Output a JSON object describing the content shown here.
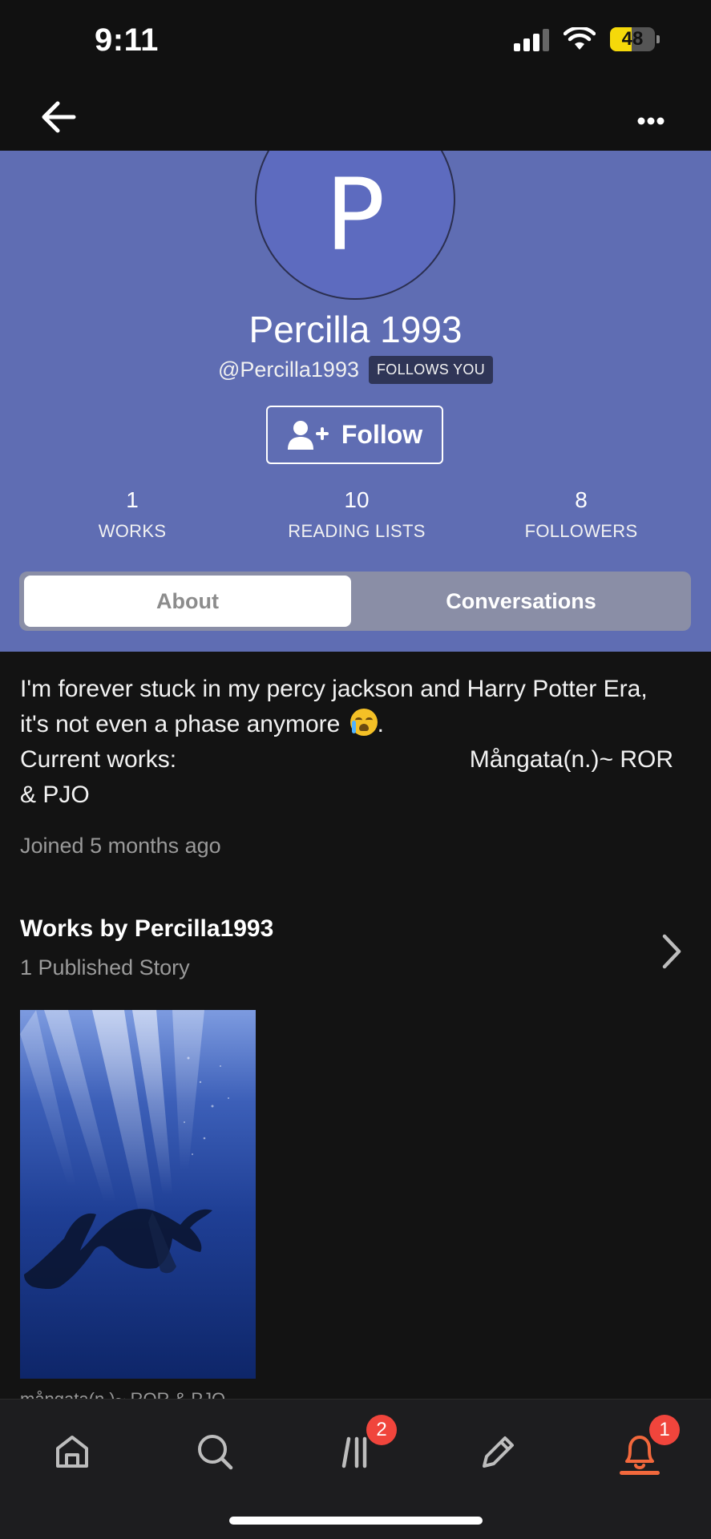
{
  "status_bar": {
    "time": "9:11",
    "battery": "48"
  },
  "nav": {
    "back_icon": "arrow-left-icon",
    "more_icon": "more-dots-icon"
  },
  "profile": {
    "avatar_letter": "P",
    "display_name": "Percilla 1993",
    "handle": "@Percilla1993",
    "follows_badge": "FOLLOWS YOU",
    "follow_label": "Follow",
    "stats": [
      {
        "value": "1",
        "label": "WORKS"
      },
      {
        "value": "10",
        "label": "READING LISTS"
      },
      {
        "value": "8",
        "label": "FOLLOWERS"
      }
    ],
    "tabs": {
      "about": "About",
      "conversations": "Conversations"
    }
  },
  "about": {
    "bio_line1": "I'm forever stuck in my percy jackson and Harry Potter Era,",
    "bio_line2": "it's not even a phase anymore",
    "bio_line2_end": ".",
    "current_works_label": "Current works:",
    "current_works_title": "Mångata(n.)~ ROR",
    "bio_line4": "& PJO",
    "joined": "Joined 5 months ago"
  },
  "works": {
    "title": "Works by Percilla1993",
    "subtitle": "1 Published Story",
    "cover_caption": "mångata(n.)~ ROR & PJO"
  },
  "bottom_nav": {
    "items": [
      "home-icon",
      "search-icon",
      "library-icon",
      "write-icon",
      "notifications-icon"
    ],
    "library_badge": "2",
    "notifications_badge": "1"
  },
  "colors": {
    "header_bg": "#5f6db3",
    "accent": "#f2683c",
    "badge": "#f0453c"
  }
}
